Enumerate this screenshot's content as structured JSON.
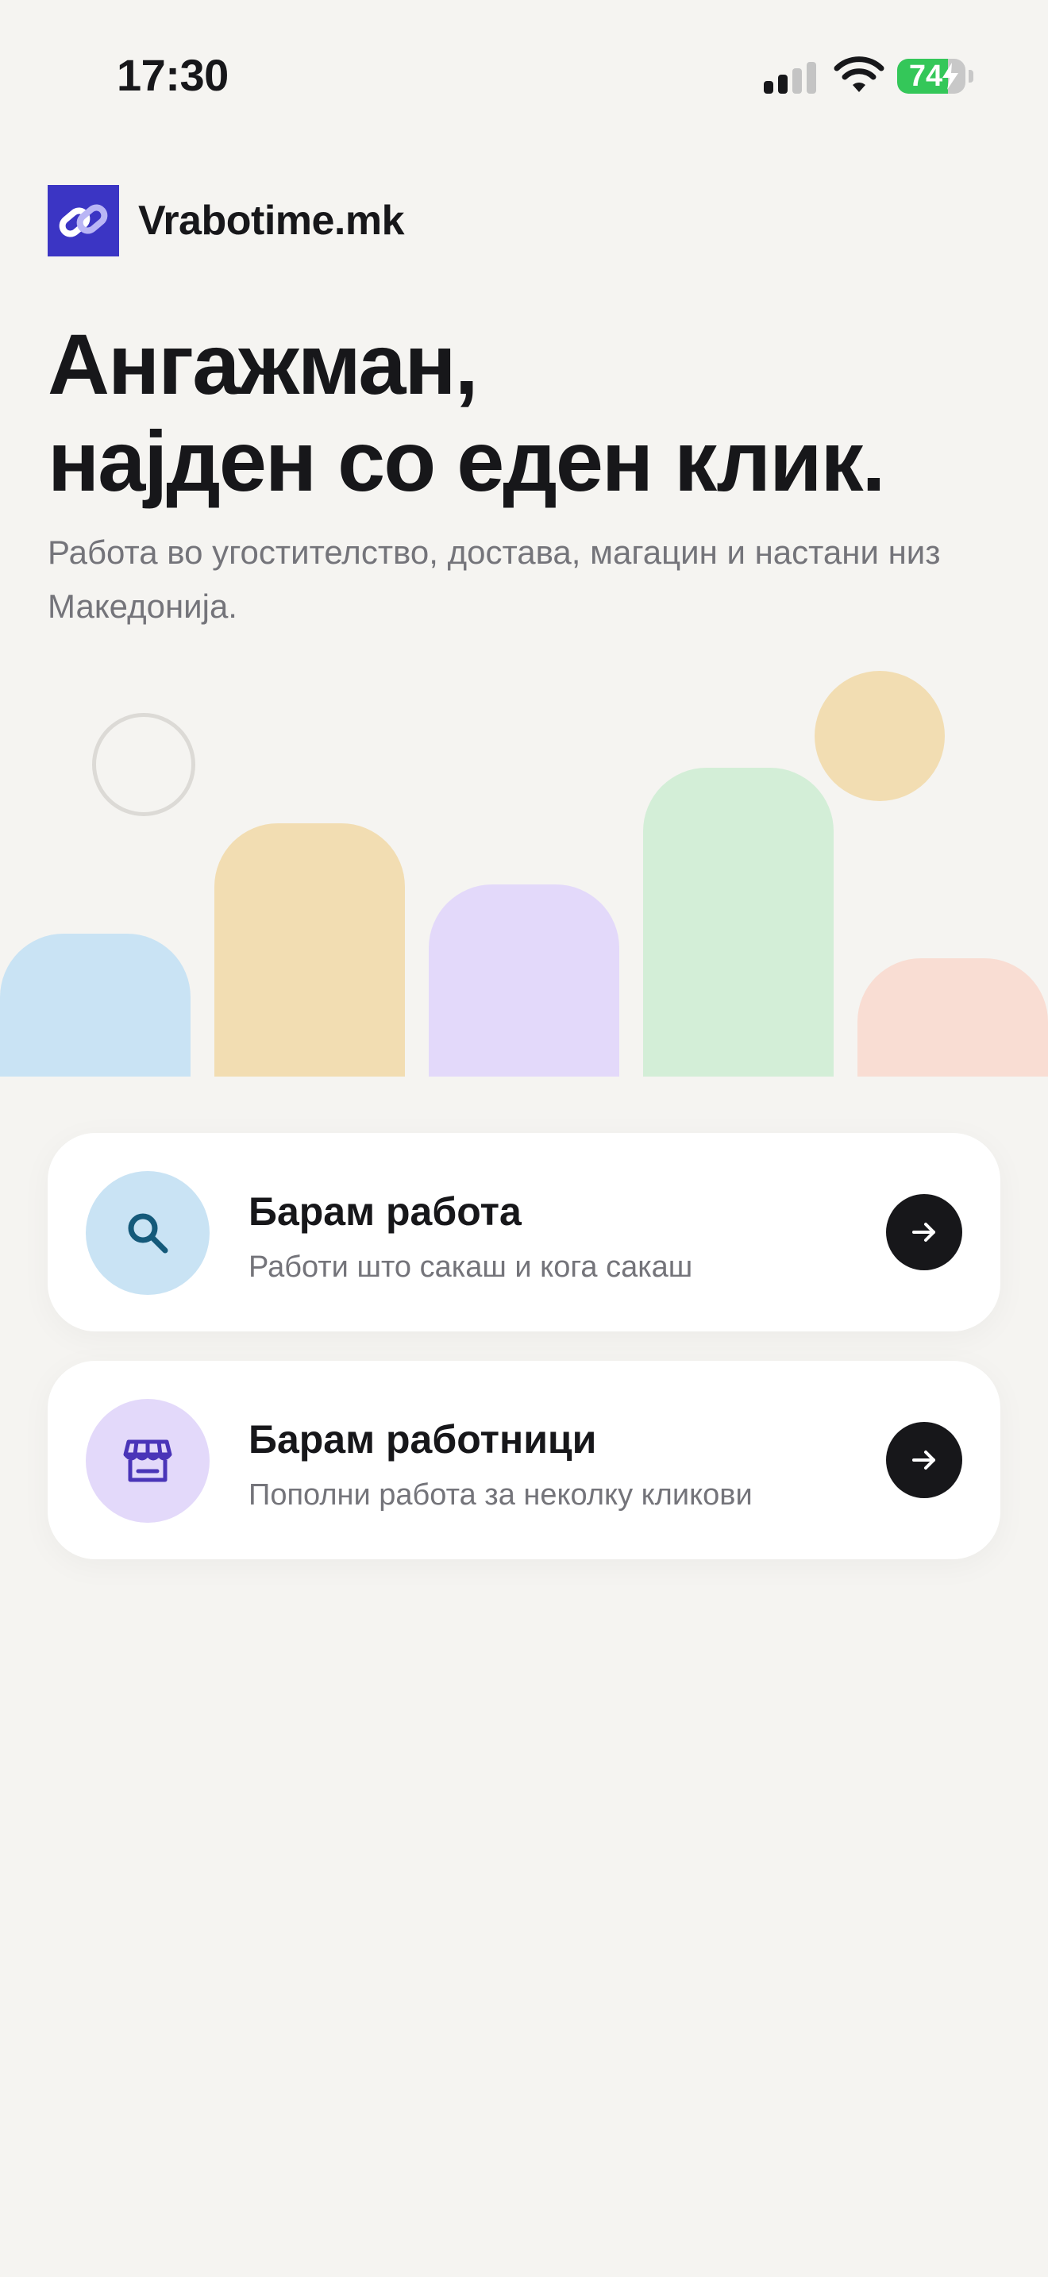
{
  "status_bar": {
    "time": "17:30",
    "battery_percent": 74,
    "battery_label": "74",
    "signal_bars_active": 2,
    "signal_bars_total": 4,
    "charging": true,
    "icons": [
      "cellular-signal-icon",
      "wifi-icon",
      "battery-charging-icon"
    ]
  },
  "brand": {
    "name": "Vrabotime.mk",
    "logo_icon": "chain-link-logo-icon",
    "logo_color": "#3b35c4"
  },
  "hero": {
    "title_line1": "Ангажман,",
    "title_line2": "најден со еден клик.",
    "subtitle": "Работа во угостителство, достава, магацин и настани низ Македонија."
  },
  "illustration": {
    "colors": {
      "blue": "#c9e3f4",
      "yellow": "#f2ddb2",
      "purple": "#e3d9fa",
      "green": "#d3eed7",
      "pink": "#f9ddd3",
      "ring": "#dcdad6"
    }
  },
  "cards": [
    {
      "title": "Барам работа",
      "subtitle": "Работи што сакаш и кога сакаш",
      "icon": "search-icon",
      "icon_bg": "#c9e3f4",
      "icon_color": "#155a7a"
    },
    {
      "title": "Барам работници",
      "subtitle": "Пополни работа за неколку кликови",
      "icon": "store-icon",
      "icon_bg": "#e3d9fa",
      "icon_color": "#4a35b8"
    }
  ],
  "colors": {
    "background": "#f5f4f1",
    "text_primary": "#17171a",
    "text_secondary": "#74747a",
    "arrow_button": "#17171a",
    "battery_green": "#34c759"
  }
}
